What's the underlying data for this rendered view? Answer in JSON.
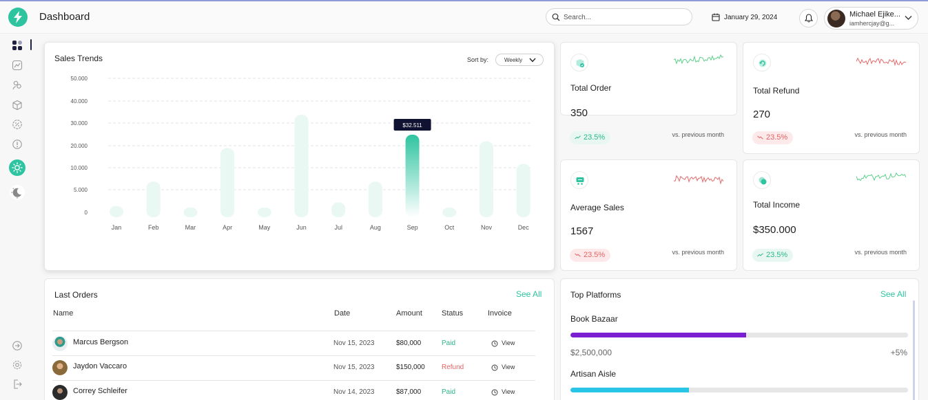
{
  "header": {
    "title": "Dashboard",
    "search_placeholder": "Search...",
    "date": "January 29, 2024",
    "user_name": "Michael Ejike...",
    "user_email": "iamhercjay@g..."
  },
  "sales_trends": {
    "title": "Sales Trends",
    "sort_label": "Sort by:",
    "sort_value": "Weekly"
  },
  "chart_data": {
    "type": "bar",
    "title": "Sales Trends",
    "categories": [
      "Jan",
      "Feb",
      "Mar",
      "Apr",
      "May",
      "Jun",
      "Jul",
      "Aug",
      "Sep",
      "Oct",
      "Nov",
      "Dec"
    ],
    "values": [
      5200,
      11500,
      2600,
      26500,
      4500,
      41500,
      6000,
      11500,
      32511,
      1500,
      29500,
      19500
    ],
    "highlight_index": 8,
    "tooltip": "$32.511",
    "y_ticks": [
      "50.000",
      "40.000",
      "30.000",
      "20.000",
      "10.000",
      "5.000",
      "0"
    ],
    "ylim": [
      0,
      50000
    ],
    "grid": true,
    "colors": {
      "bar": "#eaf8f3",
      "highlight_top": "#2ec4a0",
      "highlight_bottom": "#ffffff",
      "tooltip_bg": "#0f1230"
    }
  },
  "stats": [
    {
      "label": "Total Order",
      "value": "350",
      "change": "23.5%",
      "trend": "up",
      "note": "vs. previous month",
      "spark_color": "#5ccf8a"
    },
    {
      "label": "Total Refund",
      "value": "270",
      "change": "23.5%",
      "trend": "down",
      "note": "vs. previous month",
      "spark_color": "#e46a6a"
    },
    {
      "label": "Average Sales",
      "value": "1567",
      "change": "23.5%",
      "trend": "down",
      "note": "vs. previous month",
      "spark_color": "#e46a6a"
    },
    {
      "label": "Total Income",
      "value": "$350.000",
      "change": "23.5%",
      "trend": "up",
      "note": "vs. previous month",
      "spark_color": "#5ccf8a"
    }
  ],
  "orders": {
    "title": "Last Orders",
    "see_all": "See All",
    "columns": [
      "Name",
      "Date",
      "Amount",
      "Status",
      "Invoice"
    ],
    "rows": [
      {
        "name": "Marcus Bergson",
        "date": "Nov 15, 2023",
        "amount": "$80,000",
        "status": "Paid",
        "invoice": "View"
      },
      {
        "name": "Jaydon Vaccaro",
        "date": "Nov 15, 2023",
        "amount": "$150,000",
        "status": "Refund",
        "invoice": "View"
      },
      {
        "name": "Correy Schleifer",
        "date": "Nov 14, 2023",
        "amount": "$87,000",
        "status": "Paid",
        "invoice": "View"
      }
    ]
  },
  "platforms": {
    "title": "Top Platforms",
    "see_all": "See All",
    "items": [
      {
        "name": "Book Bazaar",
        "amount": "$2,500,000",
        "change": "+5%",
        "progress": 0.52,
        "color": "#7a1fd1"
      },
      {
        "name": "Artisan Aisle",
        "amount": "",
        "change": "",
        "progress": 0.35,
        "color": "#29c5e6"
      }
    ]
  },
  "colors": {
    "accent": "#2ec4a0",
    "up": "#2ab886",
    "down": "#e26363"
  }
}
